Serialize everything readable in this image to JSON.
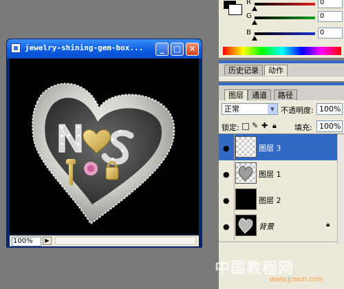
{
  "doc_window": {
    "title": "jewelry-shining-gem-box...",
    "minimize_label": "_",
    "maximize_label": "□",
    "close_label": "✕",
    "zoom": "100%"
  },
  "color_panel": {
    "channels": [
      {
        "label": "R",
        "value": "0",
        "color": "#e02020"
      },
      {
        "label": "G",
        "value": "0",
        "color": "#10a020"
      },
      {
        "label": "B",
        "value": "0",
        "color": "#2030d0"
      }
    ]
  },
  "history_panel": {
    "tabs": [
      "历史记录",
      "动作"
    ]
  },
  "layers_panel": {
    "tabs": [
      "图层",
      "通道",
      "路径"
    ],
    "blend_mode": "正常",
    "opacity_label": "不透明度:",
    "opacity_value": "100%",
    "lock_label": "锁定:",
    "fill_label": "填充:",
    "fill_value": "100%",
    "layers": [
      {
        "name": "图层 3",
        "selected": true,
        "thumb": "transparent"
      },
      {
        "name": "图层 1",
        "selected": false,
        "thumb": "heart"
      },
      {
        "name": "图层 2",
        "selected": false,
        "thumb": "black"
      },
      {
        "name": "背景",
        "selected": false,
        "thumb": "heart-dark",
        "locked": true
      }
    ]
  },
  "watermark": {
    "text": "中国教程网",
    "url": "www.jcwcn.com"
  }
}
